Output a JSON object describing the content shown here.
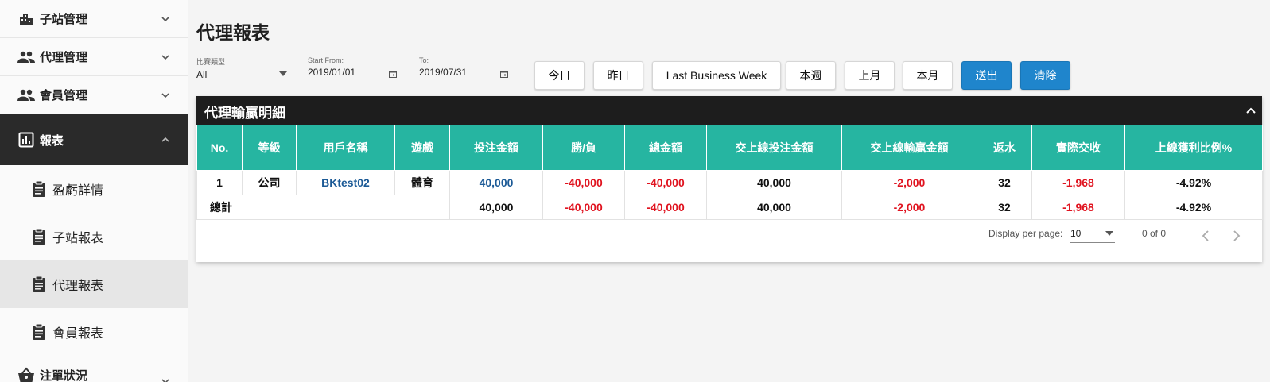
{
  "sidebar": {
    "items": [
      {
        "label": "子站管理",
        "icon": "building-icon"
      },
      {
        "label": "代理管理",
        "icon": "people-icon"
      },
      {
        "label": "會員管理",
        "icon": "people-icon"
      },
      {
        "label": "報表",
        "icon": "chart-icon"
      },
      {
        "label": "注單狀況",
        "icon": "basket-icon"
      }
    ],
    "sub_items": [
      {
        "label": "盈虧詳情"
      },
      {
        "label": "子站報表"
      },
      {
        "label": "代理報表"
      },
      {
        "label": "會員報表"
      }
    ]
  },
  "page": {
    "title": "代理報表"
  },
  "filters": {
    "game_type_label": "比賽類型",
    "game_type_value": "All",
    "start_label": "Start From:",
    "start_value": "2019/01/01",
    "to_label": "To:",
    "to_value": "2019/07/31"
  },
  "buttons": {
    "today": "今日",
    "yesterday": "昨日",
    "last_business_week": "Last Business Week",
    "this_week": "本週",
    "last_month": "上月",
    "this_month": "本月",
    "submit": "送出",
    "clear": "清除"
  },
  "panel": {
    "title": "代理輸贏明細"
  },
  "table": {
    "headers": [
      "No.",
      "等級",
      "用戶名稱",
      "遊戲",
      "投注金額",
      "勝/負",
      "總金額",
      "交上線投注金額",
      "交上線輸贏金額",
      "返水",
      "實際交收",
      "上線獲利比例%"
    ],
    "row": {
      "no": "1",
      "level": "公司",
      "user": "BKtest02",
      "game": "體育",
      "bet": "40,000",
      "winloss": "-40,000",
      "total": "-40,000",
      "upline_bet": "40,000",
      "upline_winloss": "-2,000",
      "rebate": "32",
      "settle": "-1,968",
      "ratio": "-4.92%"
    },
    "total": {
      "label": "總計",
      "bet": "40,000",
      "winloss": "-40,000",
      "total": "-40,000",
      "upline_bet": "40,000",
      "upline_winloss": "-2,000",
      "rebate": "32",
      "settle": "-1,968",
      "ratio": "-4.92%"
    }
  },
  "pagination": {
    "per_page_label": "Display per page:",
    "per_page_value": "10",
    "range": "0 of 0"
  },
  "colors": {
    "header_teal": "#26b5a1",
    "primary_blue": "#1f85cc",
    "negative_red": "#e0131f",
    "link_blue": "#1c5a96",
    "sidebar_active": "#2a2a2a"
  }
}
